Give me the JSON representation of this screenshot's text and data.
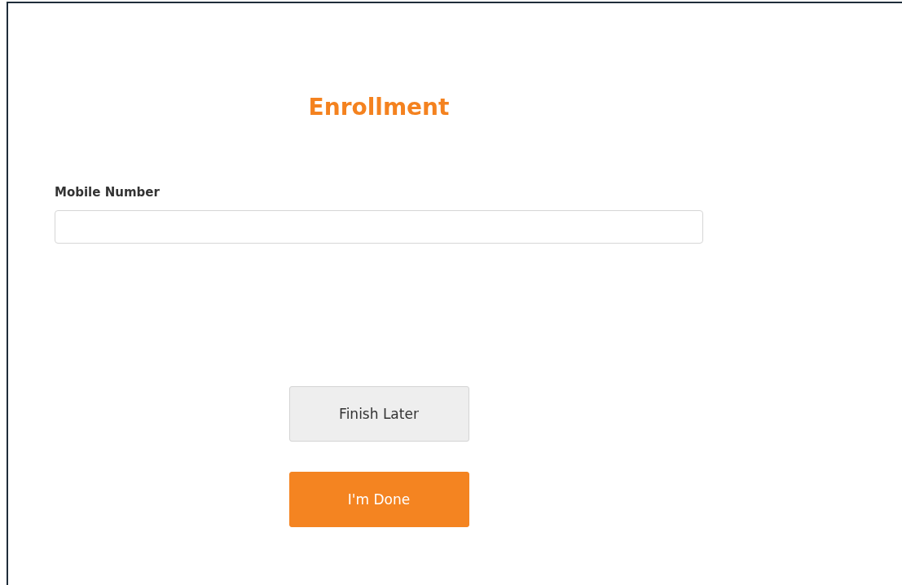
{
  "title": "Enrollment",
  "mobile_number": {
    "label": "Mobile Number"
  },
  "buttons": [
    {
      "label": "Finish Later",
      "kind": "secondary"
    },
    {
      "label": "I'm Done",
      "kind": "primary"
    }
  ]
}
